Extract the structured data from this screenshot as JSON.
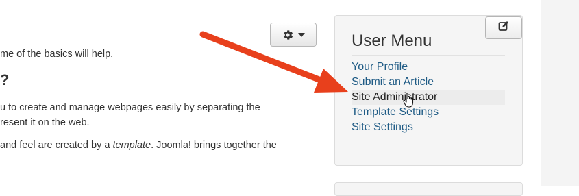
{
  "article": {
    "line1": "me of the basics will help.",
    "heading": "?",
    "line2": "u to create and manage webpages easily by separating the",
    "line3": "resent it on the web.",
    "line4_pre": "and feel are created by a ",
    "line4_em": "template",
    "line4_post": ". Joomla! brings together the"
  },
  "toolbar": {
    "gear_icon": "gear-icon",
    "caret_icon": "caret-down-icon"
  },
  "user_menu": {
    "title": "User Menu",
    "edit_icon": "edit-icon",
    "items": [
      {
        "label": "Your Profile"
      },
      {
        "label": "Submit an Article"
      },
      {
        "label": "Site Administrator",
        "active": true
      },
      {
        "label": "Template Settings"
      },
      {
        "label": "Site Settings"
      }
    ]
  },
  "annotation": {
    "arrow_color": "#e8401c",
    "link_color": "#1f5b85"
  }
}
